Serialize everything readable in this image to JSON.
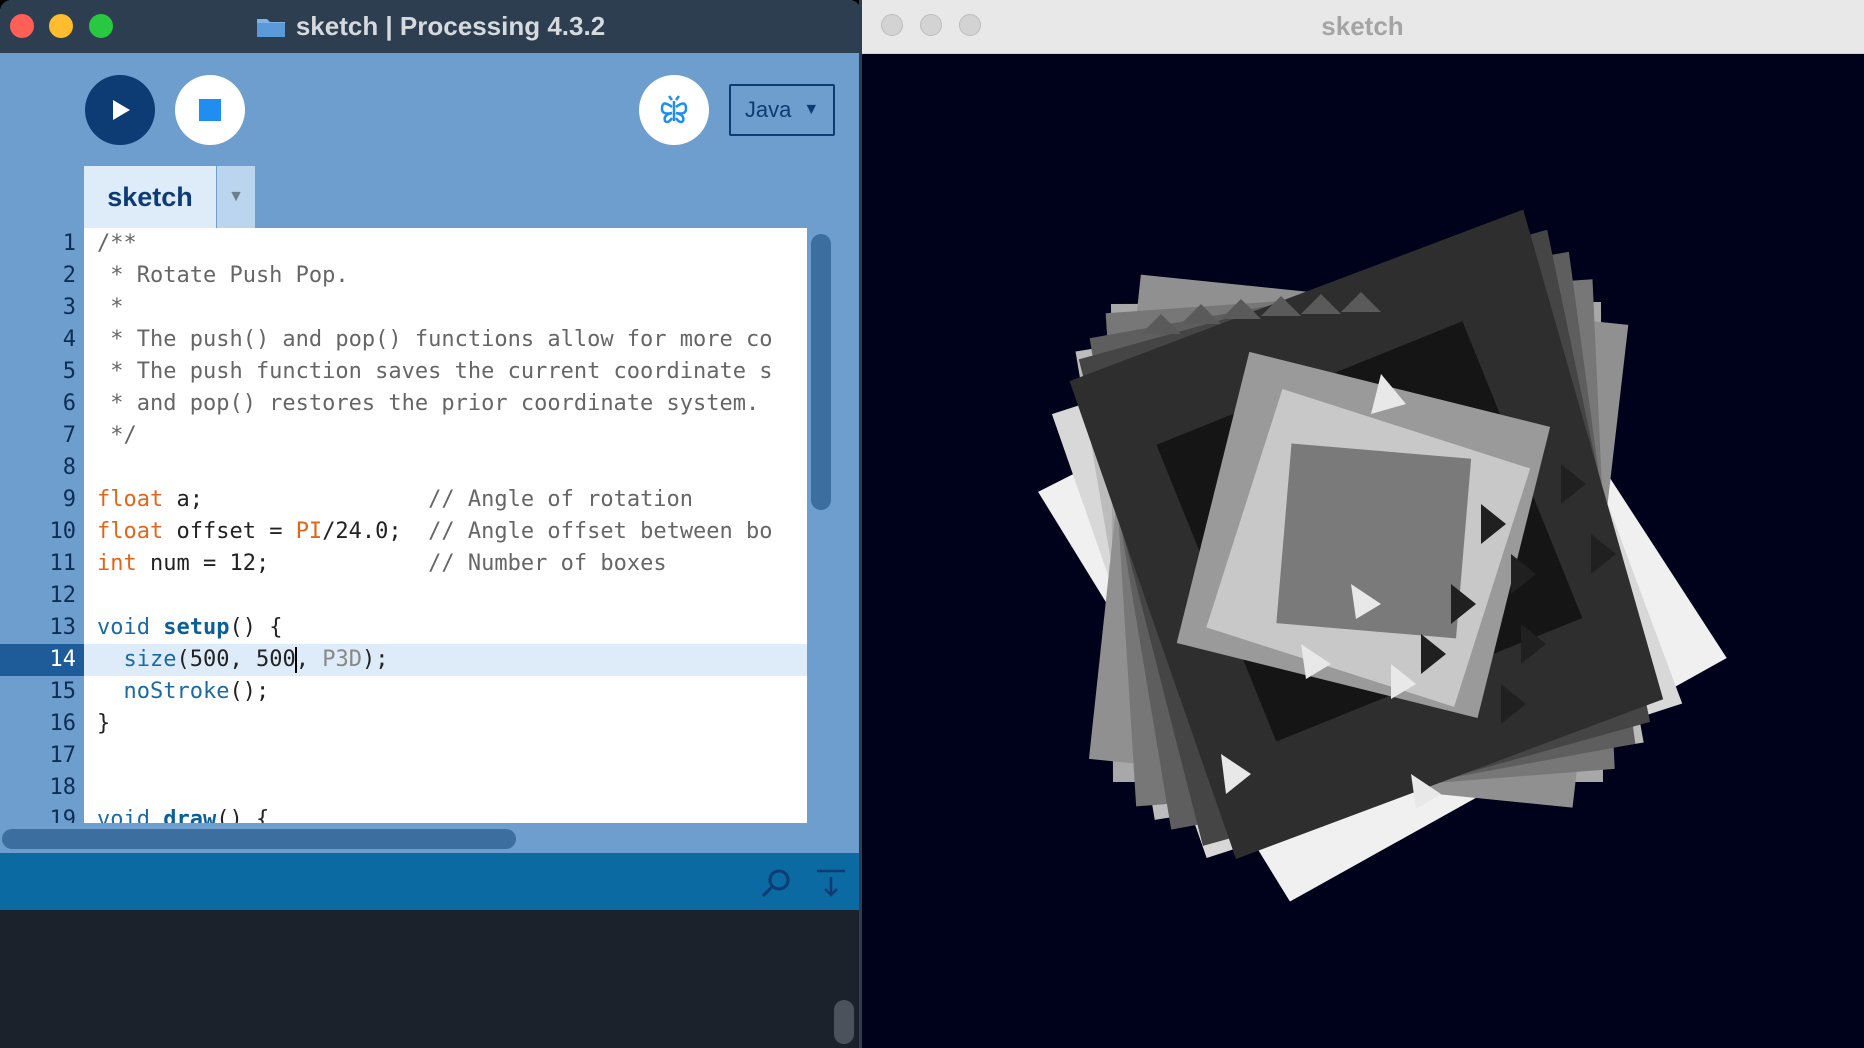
{
  "ide": {
    "title": "sketch | Processing 4.3.2",
    "mode_label": "Java",
    "mode_arrow": "▼",
    "tab_label": "sketch",
    "tab_menu_arrow": "▼",
    "line_numbers": [
      "1",
      "2",
      "3",
      "4",
      "5",
      "6",
      "7",
      "8",
      "9",
      "10",
      "11",
      "12",
      "13",
      "14",
      "15",
      "16",
      "17",
      "18",
      "19"
    ],
    "active_line": "14",
    "code": {
      "l1": "/**",
      "l2": " * Rotate Push Pop.",
      "l3": " *",
      "l4": " * The push() and pop() functions allow for more co",
      "l5": " * The push function saves the current coordinate s",
      "l6": " * and pop() restores the prior coordinate system.",
      "l7": " */",
      "l9_kw": "float",
      "l9_rest": " a;                 ",
      "l9_cmt": "// Angle of rotation",
      "l10_kw": "float",
      "l10_a": " offset = ",
      "l10_const": "PI",
      "l10_b": "/24.0;  ",
      "l10_cmt": "// Angle offset between bo",
      "l11_kw": "int",
      "l11_rest": " num = 12;            ",
      "l11_cmt": "// Number of boxes",
      "l13_kw": "void",
      "l13_fn": "setup",
      "l13_rest": "() {",
      "l14_indent": "  ",
      "l14_fn": "size",
      "l14_a": "(500, 500",
      "l14_b": ", ",
      "l14_const": "P3D",
      "l14_c": ");",
      "l15_indent": "  ",
      "l15_fn": "noStroke",
      "l15_rest": "();",
      "l16": "}",
      "l19_kw": "void",
      "l19_fn": "draw",
      "l19_rest": "() {"
    }
  },
  "sketch_window": {
    "title": "sketch",
    "background_color": "#00011a"
  },
  "colors": {
    "ide_background": "#6d9ecd",
    "title_bar": "#2c3e50",
    "run_button": "#0d3b73",
    "keyword_orange": "#e2661a",
    "function_blue": "#1c6aa3",
    "status_bar": "#0a6aa1",
    "console": "#1c222c"
  },
  "icons": {
    "run": "play-icon",
    "stop": "stop-icon",
    "debug": "debugger-butterfly-icon",
    "find": "search-icon",
    "console_toggle": "collapse-console-icon",
    "folder": "folder-icon"
  }
}
